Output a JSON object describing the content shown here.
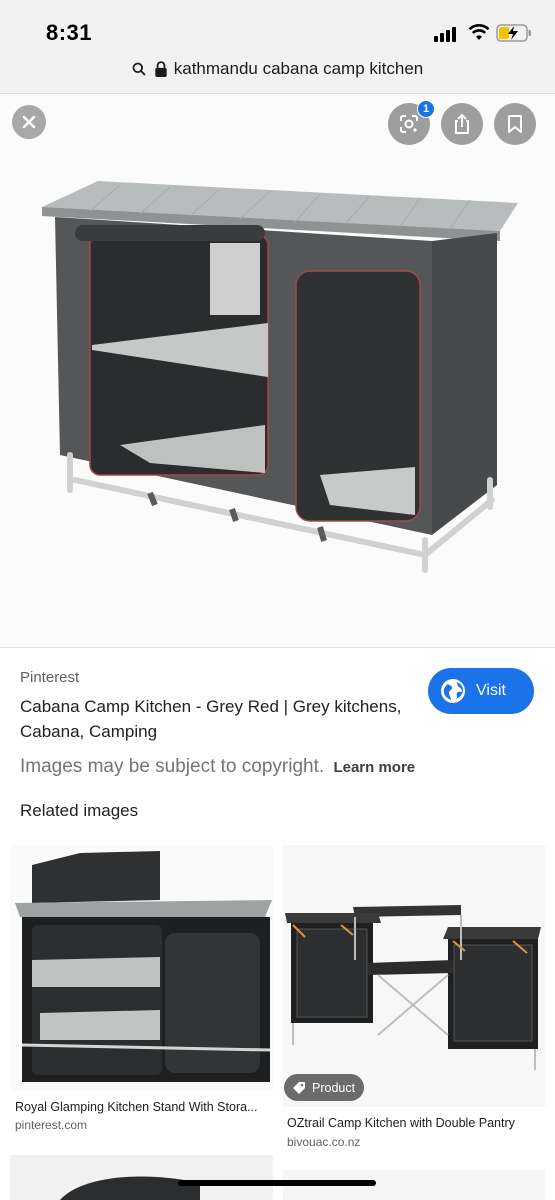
{
  "status_bar": {
    "time": "8:31"
  },
  "url_bar": {
    "url": "kathmandu cabana camp kitchen"
  },
  "viewer": {
    "lens_badge": "1"
  },
  "details": {
    "source": "Pinterest",
    "title": "Cabana Camp Kitchen - Grey Red | Grey kitchens, Cabana, Camping",
    "visit_label": "Visit",
    "copyright": "Images may be subject to copyright.",
    "learn_more": "Learn more"
  },
  "related": {
    "heading": "Related images",
    "items": [
      {
        "title": "Royal Glamping Kitchen Stand With Stora...",
        "domain": "pinterest.com"
      },
      {
        "title": "OZtrail Camp Kitchen with Double Pantry",
        "domain": "bivouac.co.nz",
        "chip": "Product"
      }
    ]
  },
  "colors": {
    "accent": "#1a73e8",
    "url_bar_bg": "#f2f2f2"
  }
}
